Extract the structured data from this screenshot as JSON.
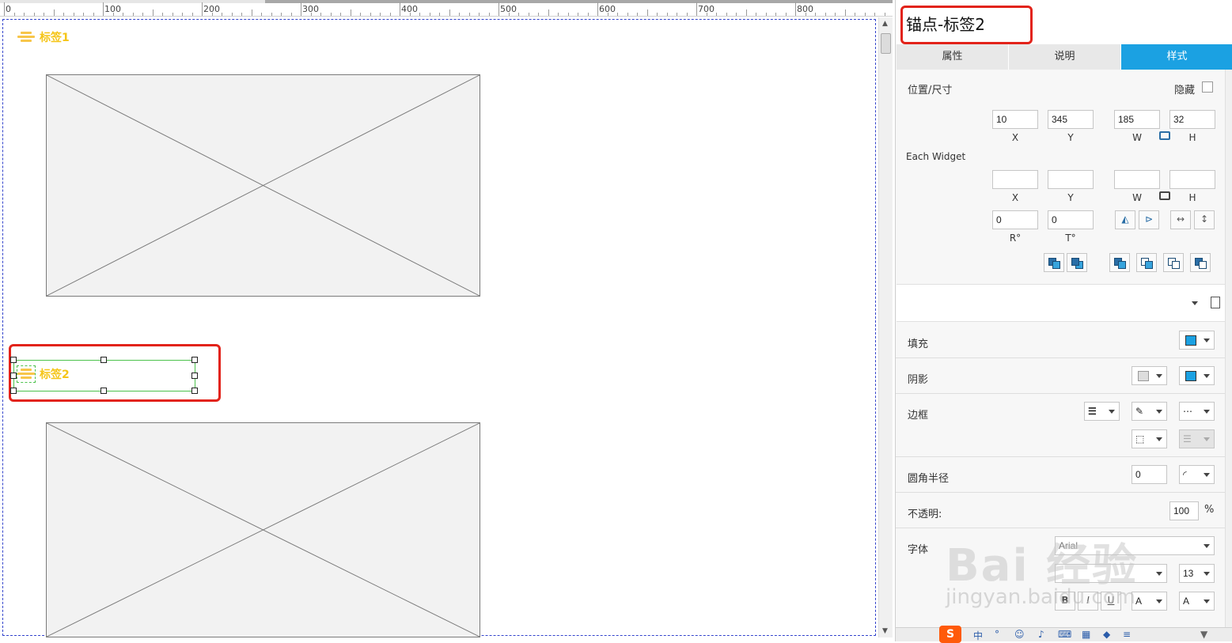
{
  "ruler": {
    "labels": [
      "0",
      "100",
      "200",
      "300",
      "400",
      "500",
      "600",
      "700",
      "800"
    ]
  },
  "canvas": {
    "anchor1": {
      "text": "标签1"
    },
    "anchor2": {
      "text": "标签2"
    }
  },
  "panel": {
    "title": "锚点-标签2",
    "tabs": [
      {
        "label": "属性",
        "active": false
      },
      {
        "label": "说明",
        "active": false
      },
      {
        "label": "样式",
        "active": true
      }
    ],
    "position_size": {
      "label": "位置/尺寸",
      "hidden_label": "隐藏",
      "x": "10",
      "y": "345",
      "w": "185",
      "h": "32",
      "cap_x": "X",
      "cap_y": "Y",
      "cap_w": "W",
      "cap_h": "H"
    },
    "each_widget": {
      "label": "Each Widget",
      "cap_x": "X",
      "cap_y": "Y",
      "cap_w": "W",
      "cap_h": "H",
      "r": "0",
      "t": "0",
      "cap_r": "R°",
      "cap_t": "T°"
    },
    "fill": {
      "label": "填充",
      "color": "#1ba1e2"
    },
    "shadow": {
      "label": "阴影",
      "color": "#1ba1e2"
    },
    "border": {
      "label": "边框"
    },
    "corner_radius": {
      "label": "圆角半径",
      "value": "0"
    },
    "opacity": {
      "label": "不透明:",
      "value": "100",
      "unit": "%"
    },
    "font": {
      "label": "字体",
      "family": "Arial",
      "size": "13"
    }
  },
  "accent_color": "#1ba1e2",
  "anchor_color": "#f5c518",
  "highlight_color": "#e2231a",
  "watermark": {
    "logo": "Bai 经验",
    "url": "jingyan.baidu.com"
  }
}
